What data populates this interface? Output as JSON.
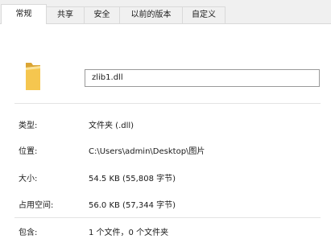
{
  "tabs": [
    {
      "label": "常规"
    },
    {
      "label": "共享"
    },
    {
      "label": "安全"
    },
    {
      "label": "以前的版本"
    },
    {
      "label": "自定义"
    }
  ],
  "file": {
    "icon": "folder-icon",
    "name": "zlib1.dll"
  },
  "properties": [
    {
      "label": "类型:",
      "value": "文件夹 (.dll)"
    },
    {
      "label": "位置:",
      "value": "C:\\Users\\admin\\Desktop\\图片"
    },
    {
      "label": "大小:",
      "value": "54.5 KB (55,808 字节)"
    },
    {
      "label": "占用空间:",
      "value": "56.0 KB (57,344 字节)"
    },
    {
      "label": "包含:",
      "value": "1 个文件，0 个文件夹"
    }
  ],
  "colors": {
    "folder": "#f5c64f",
    "tab_background": "#f0f0f0",
    "border": "#d9d9d9"
  }
}
